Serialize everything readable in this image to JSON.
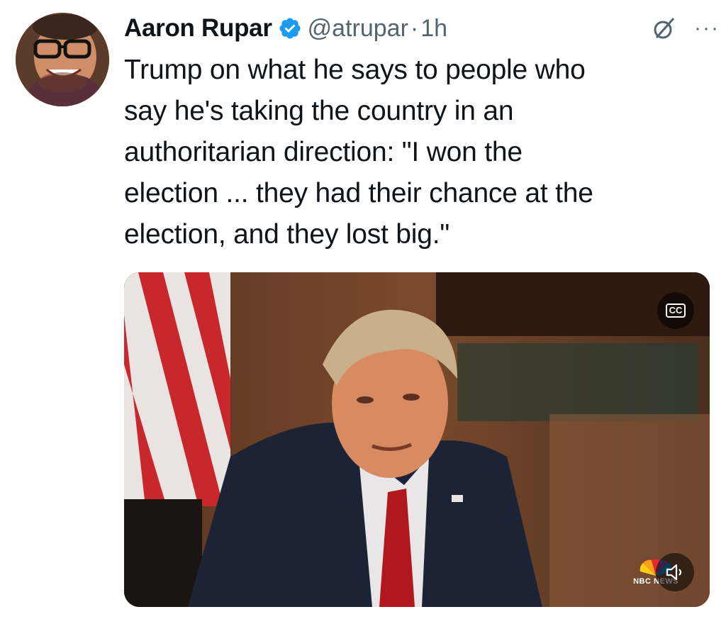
{
  "tweet": {
    "author_name": "Aaron Rupar",
    "handle": "@atrupar",
    "separator": "·",
    "time": "1h",
    "text": "Trump on what he says to people who\nsay he's taking the country in an\nauthoritarian direction: \"I won the\nelection ... they had their chance at the\nelection, and they lost big.\"",
    "more_label": "···"
  },
  "media": {
    "type": "video",
    "cc_label": "CC",
    "network_label": "NBC NEWS"
  },
  "icons": {
    "verified": "verified-badge-icon",
    "grok": "grok-icon",
    "more": "more-options-icon",
    "cc": "closed-captions-icon",
    "mute": "speaker-muted-icon",
    "network": "nbc-peacock-logo"
  },
  "colors": {
    "verified_blue": "#1d9bf0",
    "text": "#0f1419",
    "secondary": "#536471"
  }
}
